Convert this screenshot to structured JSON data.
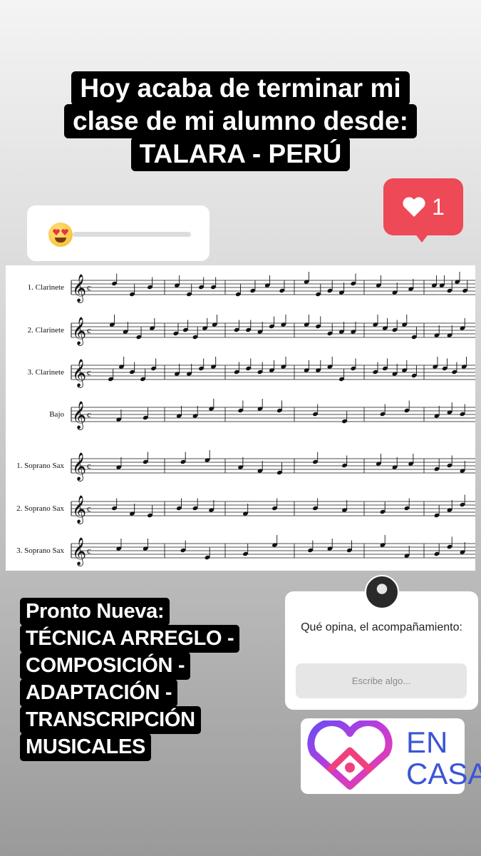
{
  "headline": {
    "lines": [
      "Hoy acaba de terminar mi",
      "clase de mi alumno desde:",
      "TALARA - PERÚ"
    ]
  },
  "slider_sticker": {
    "emoji": "heart-eyes-emoji",
    "value_percent": 0
  },
  "like_notification": {
    "icon": "heart-icon",
    "count": "1",
    "color": "#ee4956"
  },
  "score": {
    "instruments": [
      "1. Clarinete",
      "2. Clarinete",
      "3. Clarinete",
      "Bajo",
      "1. Soprano Sax",
      "2. Soprano Sax",
      "3. Soprano Sax"
    ],
    "time_signature": "c"
  },
  "promo": {
    "lines": [
      "Pronto Nueva:",
      "TÉCNICA ARREGLO -",
      "COMPOSICIÓN -",
      "ADAPTACIÓN -",
      "TRANSCRIPCIÓN",
      "MUSICALES"
    ]
  },
  "question_sticker": {
    "question": "Qué opina, el acompañamiento:",
    "placeholder": "Escribe algo..."
  },
  "en_casa_sticker": {
    "line1": "EN",
    "line2": "CASA",
    "accent": "#3a55d6"
  }
}
